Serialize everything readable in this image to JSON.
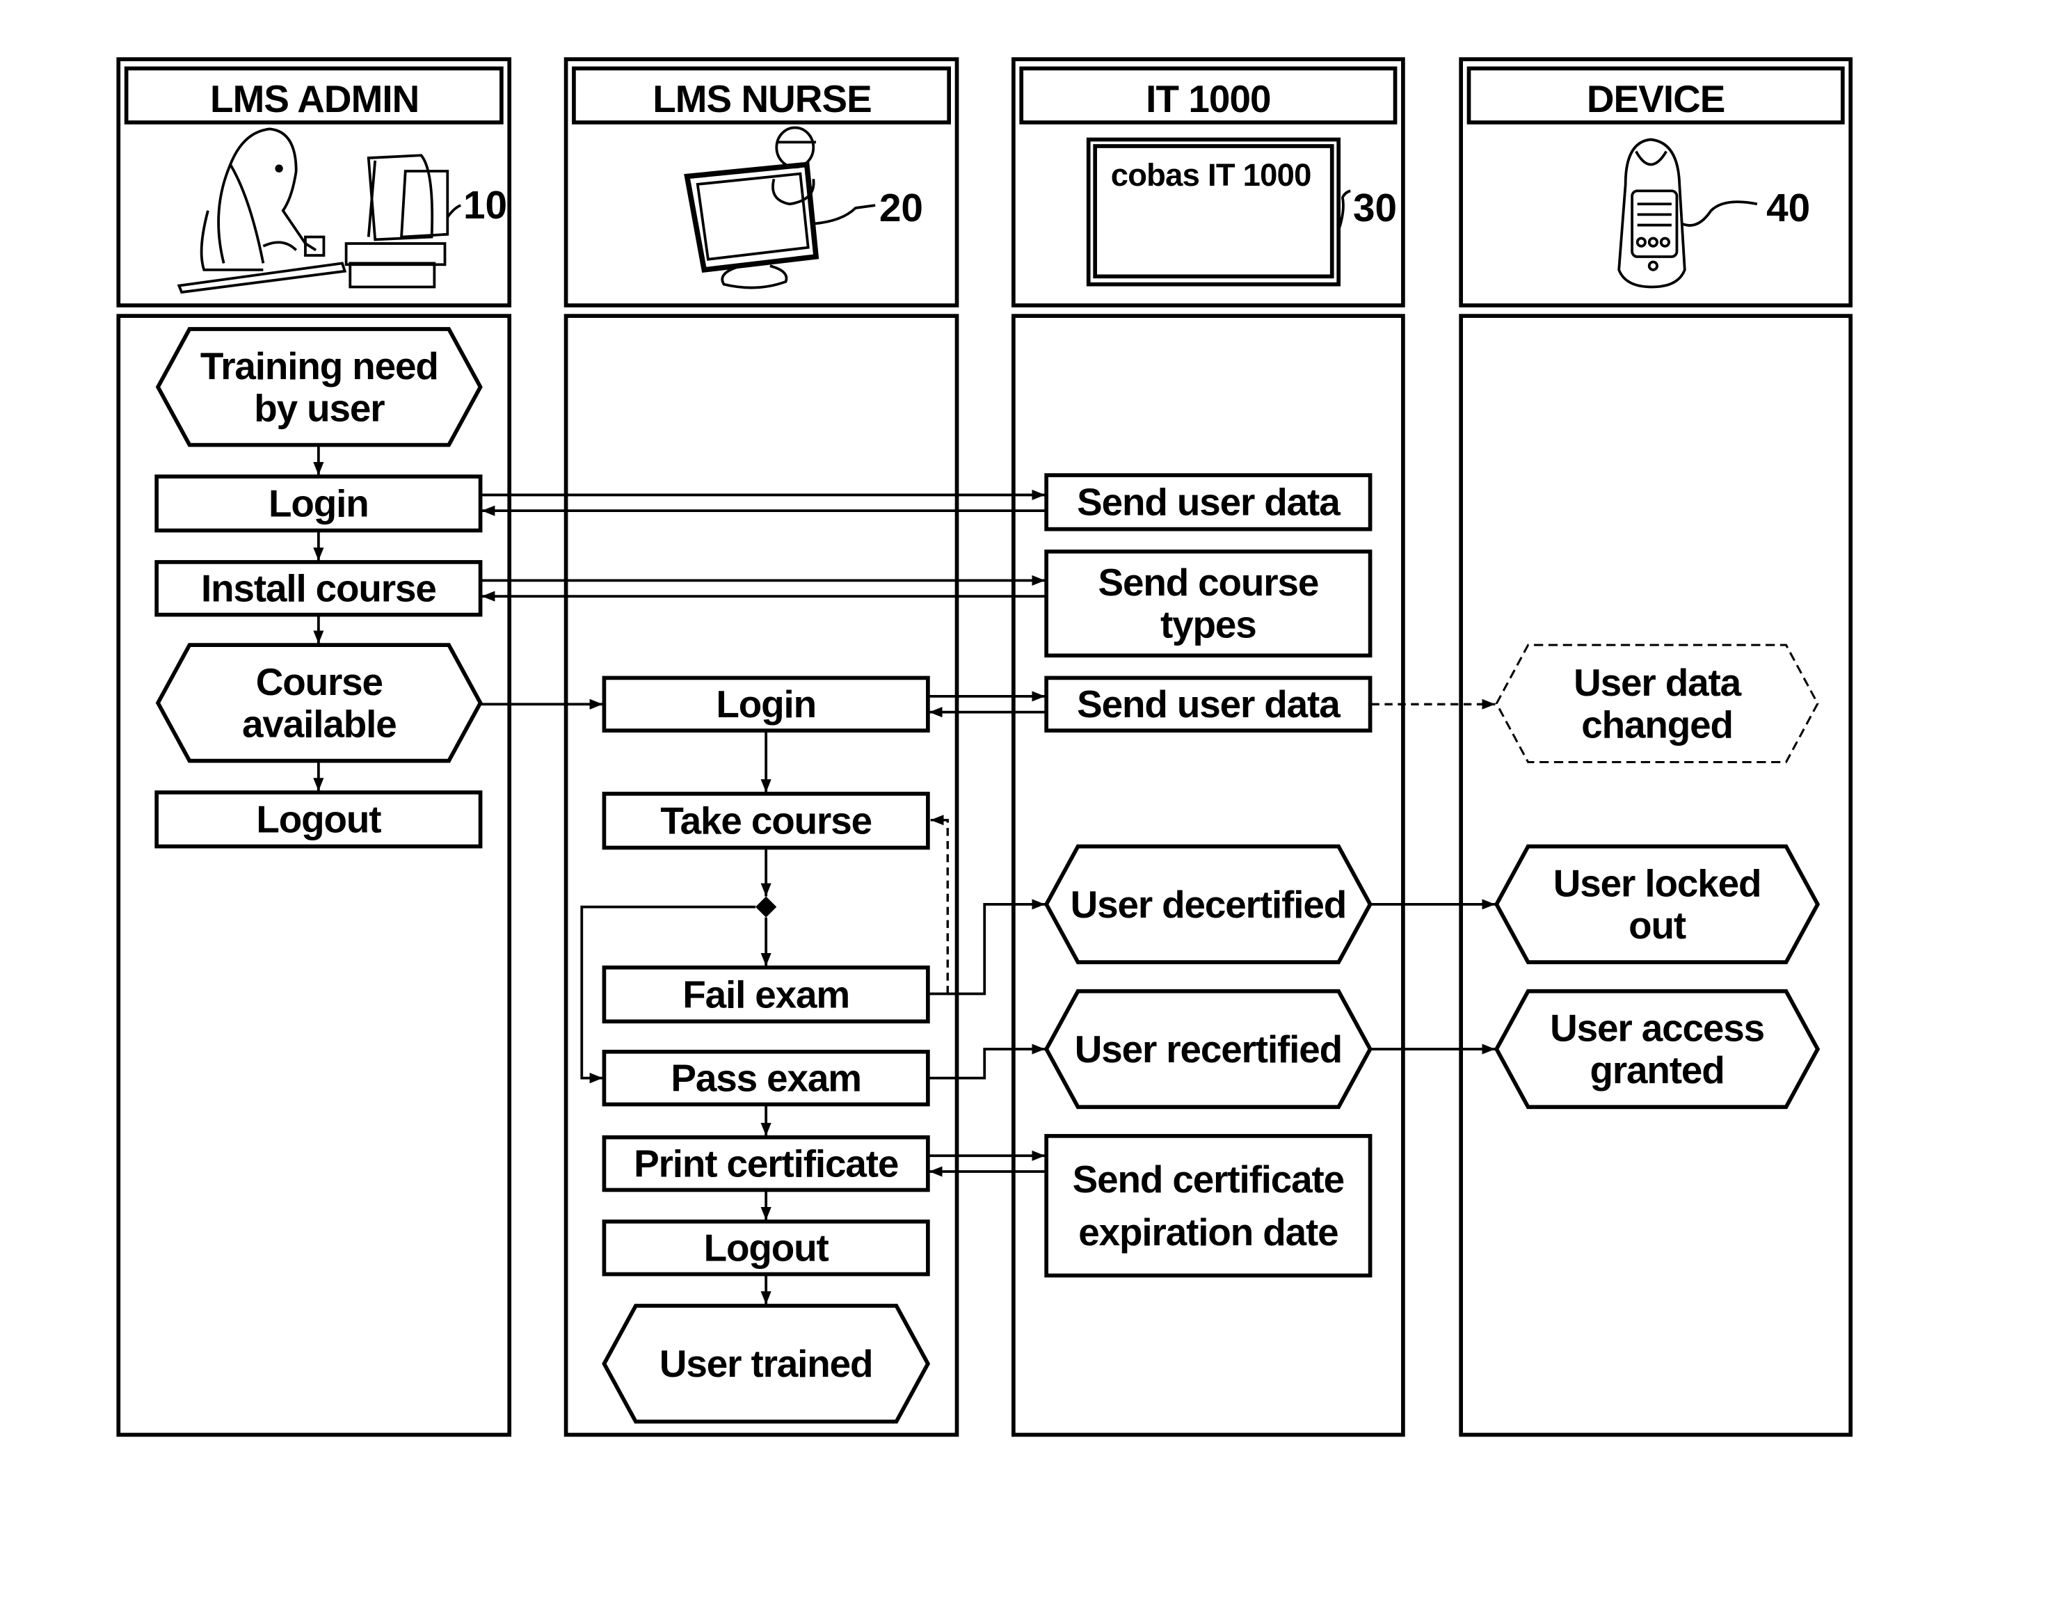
{
  "figure": {
    "type": "swimlane-flowchart",
    "lanes": [
      {
        "id": "admin",
        "title": "LMS ADMIN",
        "ref": "10",
        "icon": "admin-at-computer-icon"
      },
      {
        "id": "nurse",
        "title": "LMS NURSE",
        "ref": "20",
        "icon": "nurse-on-monitor-icon"
      },
      {
        "id": "it",
        "title": "IT 1000",
        "ref": "30",
        "icon": "it-screen-icon",
        "screen_label": "cobas IT 1000"
      },
      {
        "id": "device",
        "title": "DEVICE",
        "ref": "40",
        "icon": "handheld-device-icon"
      }
    ],
    "nodes": {
      "admin_training_need": {
        "lane": "admin",
        "shape": "hexagon",
        "lines": [
          "Training need",
          "by user"
        ]
      },
      "admin_login": {
        "lane": "admin",
        "shape": "rect",
        "lines": [
          "Login"
        ]
      },
      "admin_install_course": {
        "lane": "admin",
        "shape": "rect",
        "lines": [
          "Install course"
        ]
      },
      "admin_course_available": {
        "lane": "admin",
        "shape": "hexagon",
        "lines": [
          "Course",
          "available"
        ]
      },
      "admin_logout": {
        "lane": "admin",
        "shape": "rect",
        "lines": [
          "Logout"
        ]
      },
      "nurse_login": {
        "lane": "nurse",
        "shape": "rect",
        "lines": [
          "Login"
        ]
      },
      "nurse_take_course": {
        "lane": "nurse",
        "shape": "rect",
        "lines": [
          "Take course"
        ]
      },
      "nurse_fail_exam": {
        "lane": "nurse",
        "shape": "rect",
        "lines": [
          "Fail exam"
        ]
      },
      "nurse_pass_exam": {
        "lane": "nurse",
        "shape": "rect",
        "lines": [
          "Pass exam"
        ]
      },
      "nurse_print_certificate": {
        "lane": "nurse",
        "shape": "rect",
        "lines": [
          "Print certificate"
        ]
      },
      "nurse_logout": {
        "lane": "nurse",
        "shape": "rect",
        "lines": [
          "Logout"
        ]
      },
      "nurse_user_trained": {
        "lane": "nurse",
        "shape": "hexagon",
        "lines": [
          "User trained"
        ]
      },
      "it_send_user_data_1": {
        "lane": "it",
        "shape": "rect",
        "lines": [
          "Send user data"
        ]
      },
      "it_send_course_types": {
        "lane": "it",
        "shape": "rect",
        "lines": [
          "Send course",
          "types"
        ]
      },
      "it_send_user_data_2": {
        "lane": "it",
        "shape": "rect",
        "lines": [
          "Send user data"
        ]
      },
      "it_user_decertified": {
        "lane": "it",
        "shape": "hexagon",
        "lines": [
          "User decertified"
        ]
      },
      "it_user_recertified": {
        "lane": "it",
        "shape": "hexagon",
        "lines": [
          "User recertified"
        ]
      },
      "it_send_cert_expiration": {
        "lane": "it",
        "shape": "rect",
        "lines": [
          "Send certificate",
          "expiration date"
        ]
      },
      "device_user_data_changed": {
        "lane": "device",
        "shape": "hexagon",
        "style": "dashed",
        "lines": [
          "User data",
          "changed"
        ]
      },
      "device_user_locked_out": {
        "lane": "device",
        "shape": "hexagon",
        "lines": [
          "User locked",
          "out"
        ]
      },
      "device_user_access_granted": {
        "lane": "device",
        "shape": "hexagon",
        "lines": [
          "User access",
          "granted"
        ]
      }
    },
    "edges": [
      {
        "from": "admin_training_need",
        "to": "admin_login"
      },
      {
        "from": "admin_login",
        "to": "admin_install_course"
      },
      {
        "from": "admin_install_course",
        "to": "admin_course_available"
      },
      {
        "from": "admin_course_available",
        "to": "admin_logout"
      },
      {
        "from": "admin_login",
        "to": "it_send_user_data_1"
      },
      {
        "from": "it_send_user_data_1",
        "to": "admin_login"
      },
      {
        "from": "admin_install_course",
        "to": "it_send_course_types"
      },
      {
        "from": "it_send_course_types",
        "to": "admin_install_course"
      },
      {
        "from": "admin_course_available",
        "to": "nurse_login"
      },
      {
        "from": "nurse_login",
        "to": "it_send_user_data_2"
      },
      {
        "from": "it_send_user_data_2",
        "to": "nurse_login"
      },
      {
        "from": "it_send_user_data_2",
        "to": "device_user_data_changed",
        "style": "dashed"
      },
      {
        "from": "nurse_login",
        "to": "nurse_take_course"
      },
      {
        "from": "nurse_take_course",
        "to": "decision"
      },
      {
        "from": "decision",
        "to": "nurse_fail_exam"
      },
      {
        "from": "decision",
        "to": "nurse_pass_exam"
      },
      {
        "from": "nurse_fail_exam",
        "to": "nurse_take_course",
        "style": "dashed"
      },
      {
        "from": "nurse_fail_exam",
        "to": "it_user_decertified"
      },
      {
        "from": "it_user_decertified",
        "to": "device_user_locked_out"
      },
      {
        "from": "nurse_pass_exam",
        "to": "it_user_recertified"
      },
      {
        "from": "it_user_recertified",
        "to": "device_user_access_granted"
      },
      {
        "from": "nurse_pass_exam",
        "to": "nurse_print_certificate"
      },
      {
        "from": "nurse_print_certificate",
        "to": "it_send_cert_expiration"
      },
      {
        "from": "it_send_cert_expiration",
        "to": "nurse_print_certificate"
      },
      {
        "from": "nurse_print_certificate",
        "to": "nurse_logout"
      },
      {
        "from": "nurse_logout",
        "to": "nurse_user_trained"
      }
    ]
  }
}
